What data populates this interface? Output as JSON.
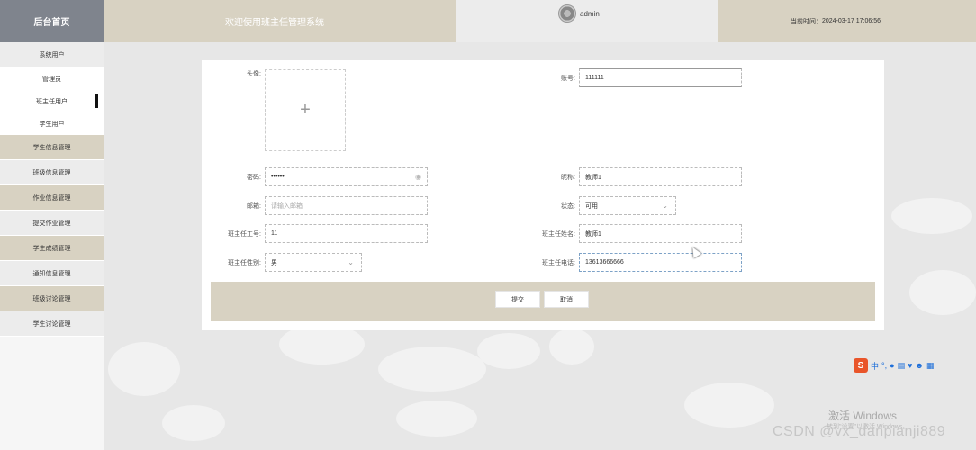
{
  "header": {
    "logo": "后台首页",
    "welcome": "欢迎使用班主任管理系统",
    "username": "admin",
    "time_label": "当前时间：",
    "time_value": "2024-03-17 17:06:56"
  },
  "sidebar": {
    "groups": [
      {
        "label": "系统用户"
      },
      {
        "label": "学生信息管理"
      },
      {
        "label": "班级信息管理"
      },
      {
        "label": "作业信息管理"
      },
      {
        "label": "提交作业管理"
      },
      {
        "label": "学生成绩管理"
      },
      {
        "label": "通知信息管理"
      },
      {
        "label": "班级讨论管理"
      },
      {
        "label": "学生讨论管理"
      }
    ],
    "subitems": [
      {
        "label": "管理员"
      },
      {
        "label": "班主任用户"
      },
      {
        "label": "学生用户"
      }
    ]
  },
  "form": {
    "avatar_label": "头像:",
    "account_label": "账号:",
    "account_value": "111111",
    "password_label": "密码:",
    "password_value": "••••••",
    "nickname_label": "昵称:",
    "nickname_value": "教师1",
    "email_label": "邮箱:",
    "email_placeholder": "请输入邮箱",
    "status_label": "状态:",
    "status_value": "可用",
    "teacher_id_label": "班主任工号:",
    "teacher_id_value": "11",
    "teacher_name_label": "班主任姓名:",
    "teacher_name_value": "教师1",
    "gender_label": "班主任性别:",
    "gender_value": "男",
    "phone_label": "班主任电话:",
    "phone_value": "13613666666",
    "submit_label": "提交",
    "cancel_label": "取消"
  },
  "taskbar": {
    "ime_logo": "S",
    "ime_mode": "中"
  },
  "watermarks": {
    "activate": "激活 Windows",
    "activate_sub": "转到\"设置\"以激活 Windows。",
    "csdn": "CSDN @vx_danpianji889"
  }
}
